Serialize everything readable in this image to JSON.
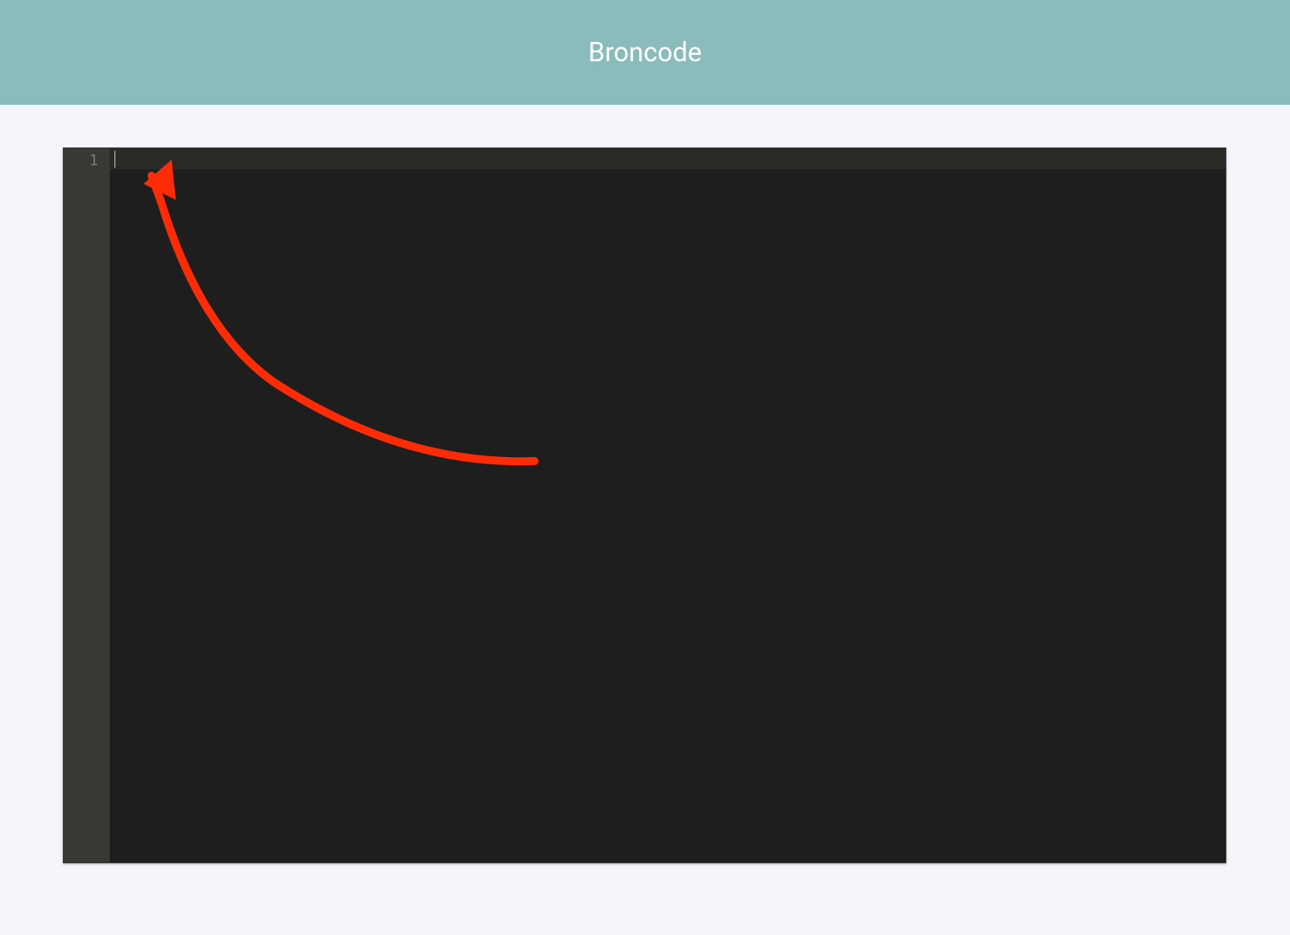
{
  "header": {
    "title": "Broncode"
  },
  "editor": {
    "lines": [
      "1"
    ],
    "content": "",
    "cursor_line": 1,
    "cursor_col": 0
  },
  "annotation": {
    "type": "arrow",
    "color": "#fd2c07",
    "description": "curved arrow pointing to code editor cursor"
  }
}
